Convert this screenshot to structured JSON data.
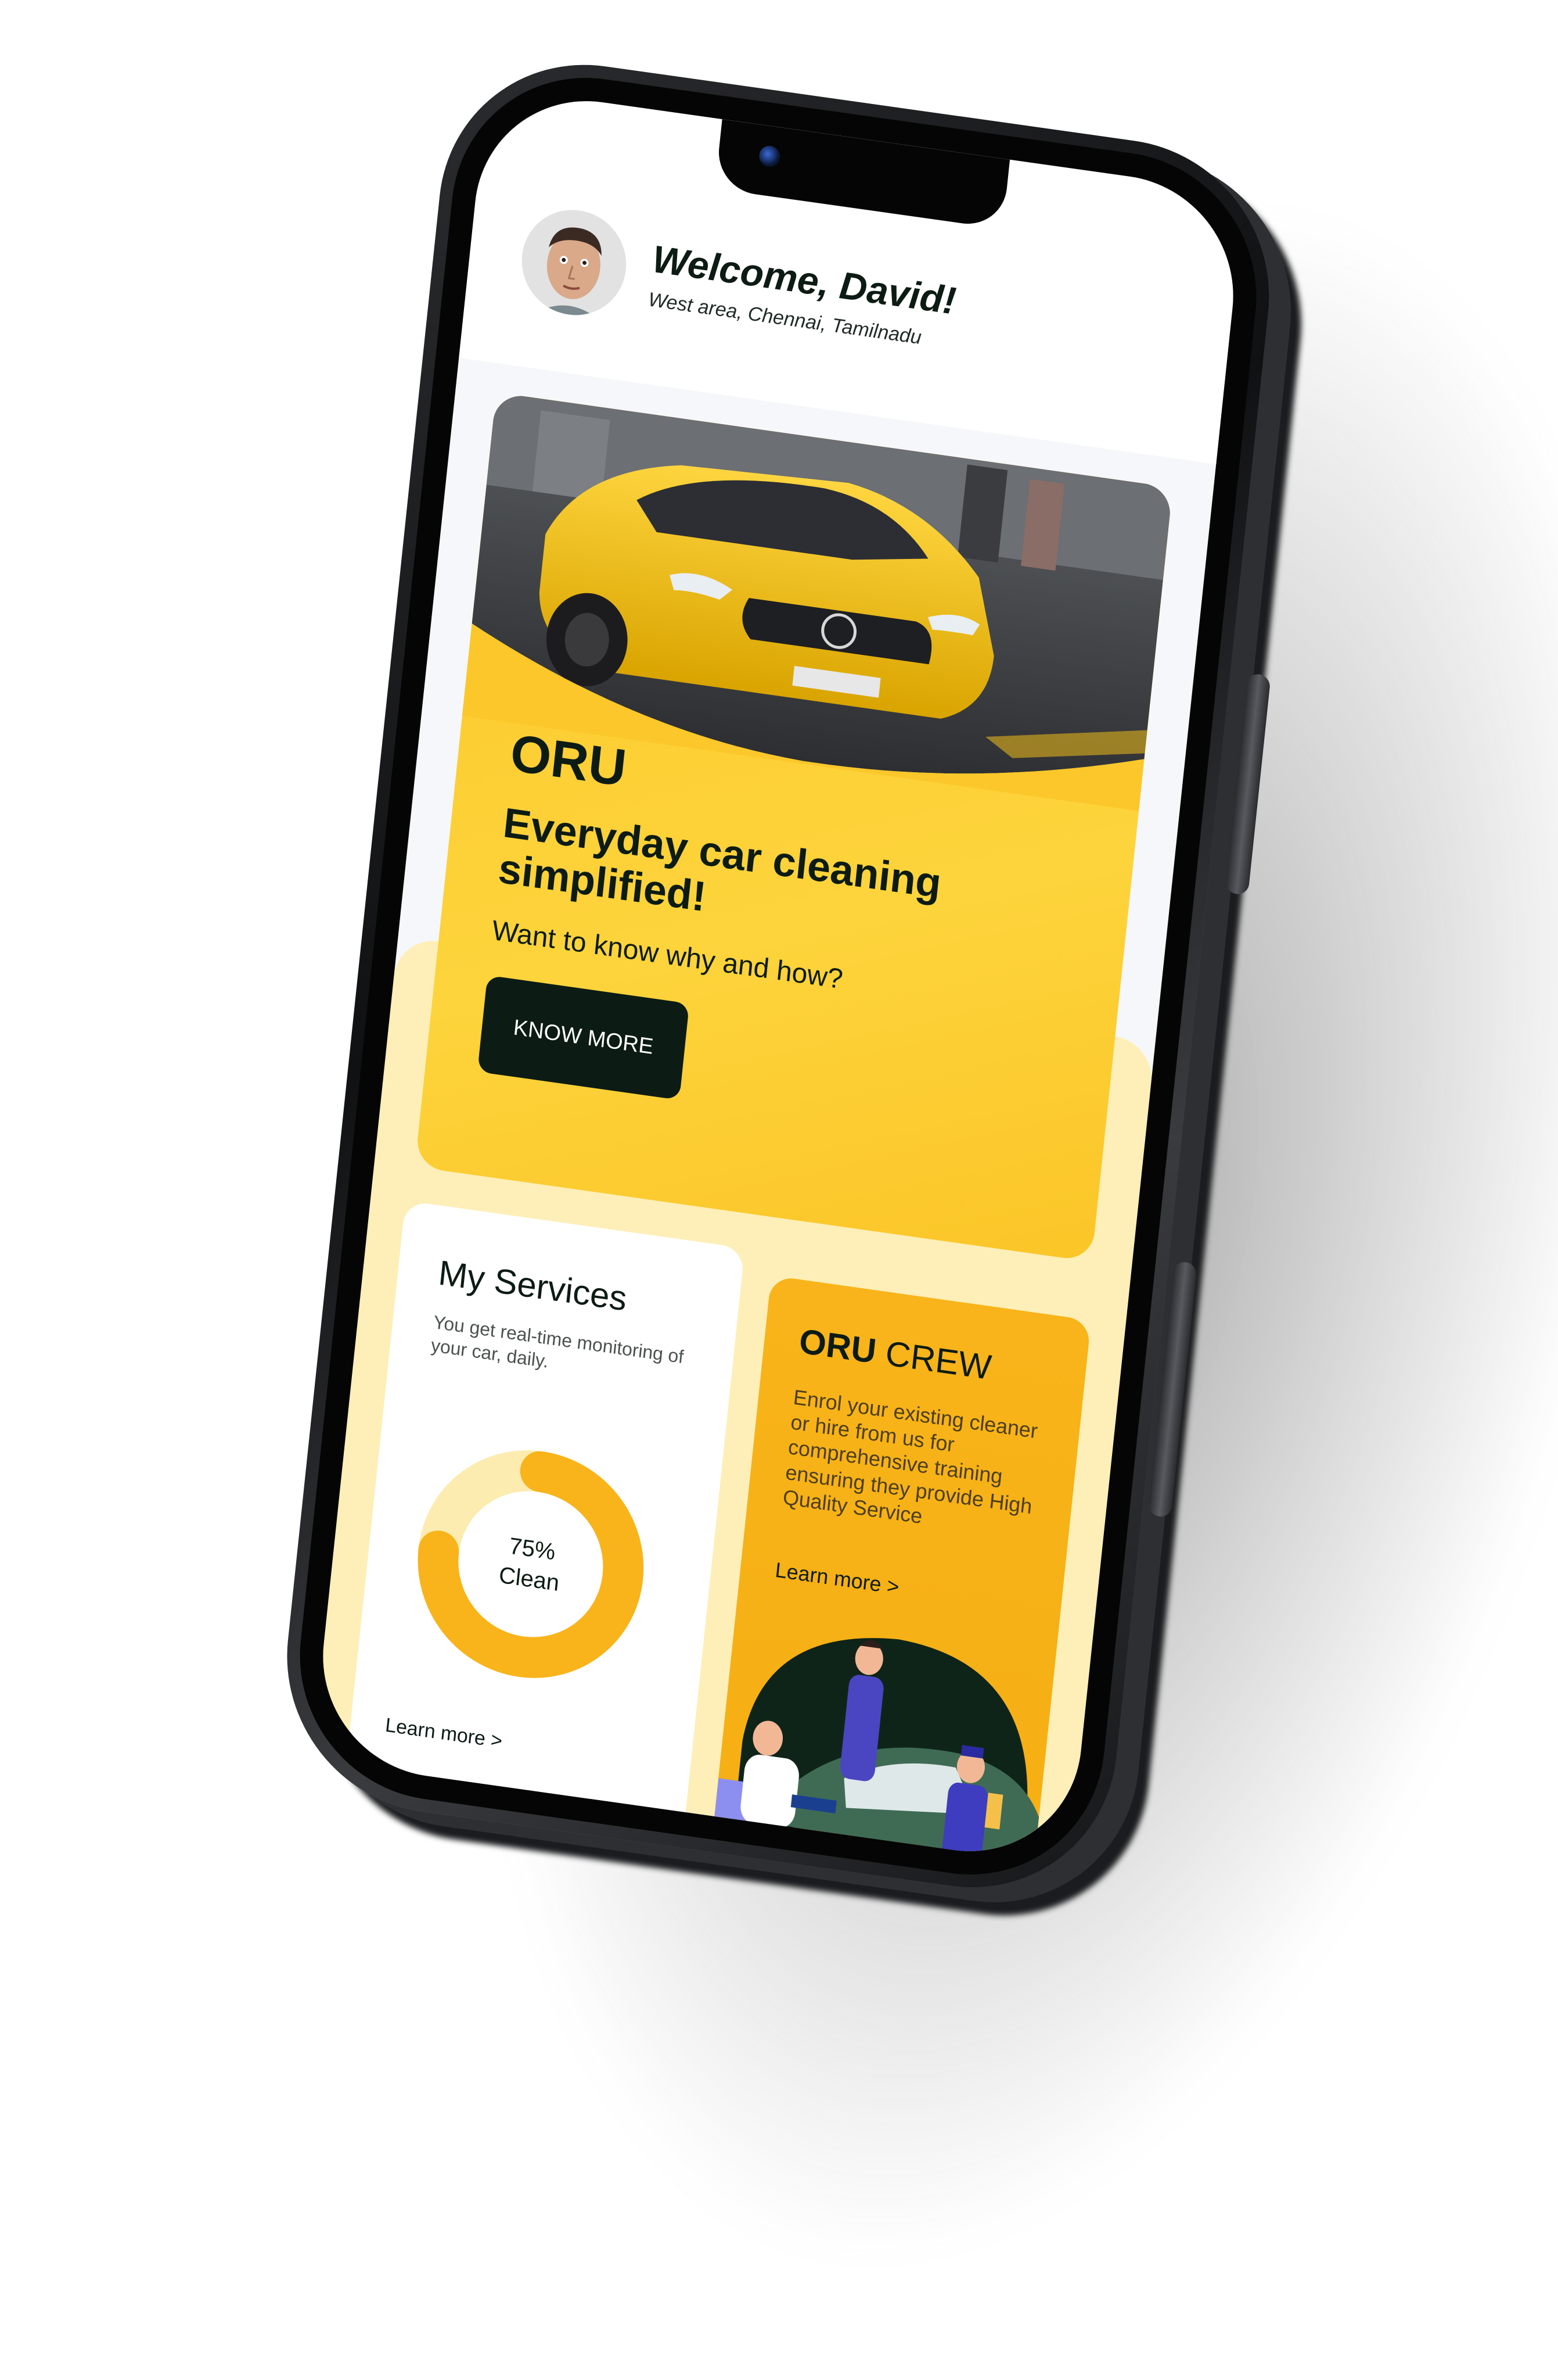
{
  "header": {
    "welcome": "Welcome, David!",
    "location": "West area, Chennai, Tamilnadu"
  },
  "hero": {
    "brand": "ORU",
    "tagline": "Everyday car cleaning simplified!",
    "question": "Want to know why and how?",
    "cta_label": "KNOW MORE"
  },
  "services": {
    "title": "My Services",
    "description": "You get real-time monitoring of your car, daily.",
    "clean_percent_label": "75%",
    "clean_label": "Clean",
    "clean_fraction": 0.75,
    "learn_more": "Learn more >"
  },
  "crew": {
    "title_bold": "ORU",
    "title_rest": " CREW",
    "description": "Enrol your existing cleaner or hire from us for comprehensive training ensuring they provide High Quality Service",
    "learn_more": "Learn more >"
  },
  "colors": {
    "accent_yellow": "#fcc72a",
    "dark_green": "#0c1b14",
    "pale_yellow": "#fdefb7",
    "crew_orange": "#f5ae12"
  }
}
